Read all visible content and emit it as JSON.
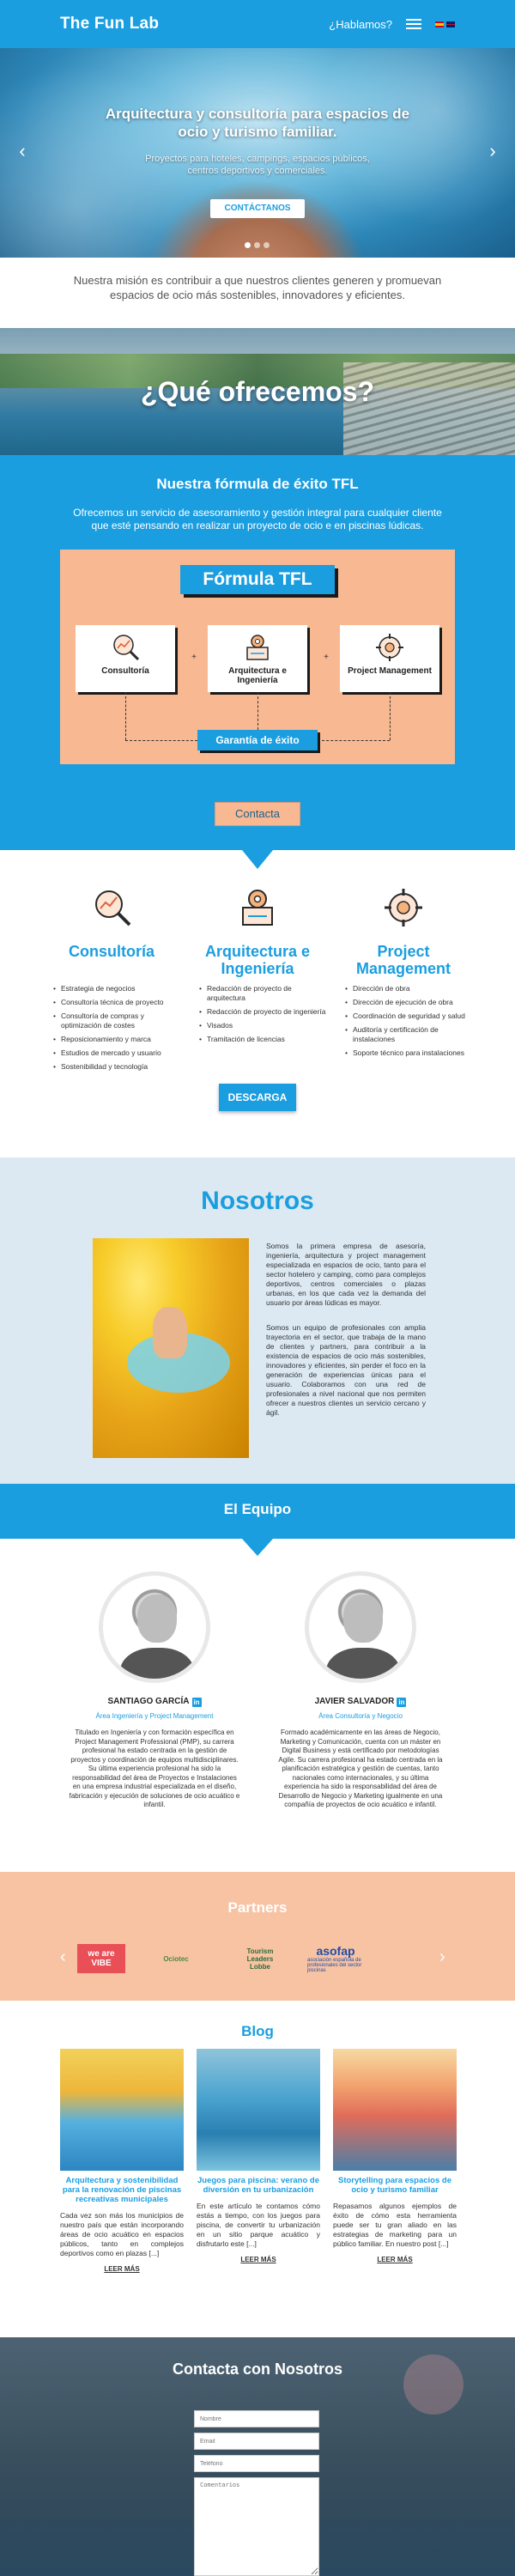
{
  "header": {
    "logo": "The Fun Lab",
    "cta": "¿Hablamos?"
  },
  "hero": {
    "title": "Arquitectura y consultoría para espacios de ocio y turismo familiar.",
    "subtitle": "Proyectos para hoteles, campings, espacios públicos, centros deportivos y comerciales.",
    "button": "CONTÁCTANOS",
    "slides": 3,
    "active_slide": 1
  },
  "mission": "Nuestra misión es contribuir a que nuestros clientes generen y promuevan espacios de ocio más sostenibles, innovadores y eficientes.",
  "offer": {
    "title": "¿Qué ofrecemos?"
  },
  "formula": {
    "heading": "Nuestra fórmula de éxito TFL",
    "description": "Ofrecemos un servicio de asesoramiento y gestión integral para cualquier cliente que esté pensando en realizar un proyecto de ocio e en piscinas lúdicas.",
    "title": "Fórmula TFL",
    "boxes": [
      {
        "label": "Consultoría",
        "icon": "magnifier-chart-icon"
      },
      {
        "label": "Arquitectura e Ingeniería",
        "icon": "blueprint-gear-icon"
      },
      {
        "label": "Project Management",
        "icon": "gear-network-icon"
      }
    ],
    "plus": "+",
    "guarantee": "Garantía de éxito",
    "button": "Contacta"
  },
  "services": {
    "columns": [
      {
        "title": "Consultoría",
        "icon": "magnifier-chart-icon",
        "items": [
          "Estrategia de negocios",
          "Consultoría técnica de proyecto",
          "Consultoría de compras y optimización de costes",
          "Reposicionamiento y marca",
          "Estudios de mercado y usuario",
          "Sostenibilidad y tecnología"
        ]
      },
      {
        "title": "Arquitectura e Ingeniería",
        "icon": "blueprint-gear-icon",
        "items": [
          "Redacción de proyecto de arquitectura",
          "Redacción de proyecto de ingeniería",
          "Visados",
          "Tramitación de licencias"
        ]
      },
      {
        "title": "Project Management",
        "icon": "gear-network-icon",
        "items": [
          "Dirección de obra",
          "Dirección de ejecución de obra",
          "Coordinación de seguridad y salud",
          "Auditoría y certificación de instalaciones",
          "Soporte técnico para instalaciones"
        ]
      }
    ],
    "download": "DESCARGA"
  },
  "about": {
    "title": "Nosotros",
    "paragraphs": [
      "Somos la primera empresa de asesoría, ingeniería, arquitectura y project management especializada en espacios de ocio, tanto para el sector hotelero y camping, como para complejos deportivos, centros comerciales o plazas urbanas, en los que cada vez la demanda del usuario por áreas lúdicas es mayor.",
      "Somos un equipo de profesionales con amplia trayectoria en el sector, que trabaja de la mano de clientes y partners, para contribuir a la existencia de espacios de ocio más sostenibles, innovadores y eficientes, sin perder el foco en la generación de experiencias únicas para el usuario. Colaboramos con una red de profesionales a nivel nacional que nos permiten ofrecer a nuestros clientes un servicio cercano y ágil."
    ]
  },
  "team": {
    "title": "El Equipo",
    "members": [
      {
        "name": "SANTIAGO GARCÍA",
        "role": "Área Ingeniería y Project Management",
        "bio": "Titulado en Ingeniería y con formación específica en Project Management Professional (PMP), su carrera profesional ha estado centrada en la gestión de proyectos y coordinación de equipos multidisciplinares. Su última experiencia profesional ha sido la responsabilidad del área de Proyectos e Instalaciones en una empresa industrial especializada en el diseño, fabricación y ejecución de soluciones de ocio acuático e infantil."
      },
      {
        "name": "JAVIER SALVADOR",
        "role": "Área Consultoría y Negocio",
        "bio": "Formado académicamente en las áreas de Negocio, Marketing y Comunicación, cuenta con un máster en Digital Business y está certificado por metodologías Agile. Su carrera profesional ha estado centrada en la planificación estratégica y gestión de cuentas, tanto nacionales como internacionales, y su última experiencia ha sido la responsabilidad del área de Desarrollo de Negocio y Marketing igualmente en una compañía de proyectos de ocio acuático e infantil."
      }
    ]
  },
  "partners": {
    "title": "Partners",
    "logos": [
      {
        "line1": "we are",
        "line2": "VIBE"
      },
      {
        "text": "Ociotec"
      },
      {
        "line1": "Tourism",
        "line2": "Leaders Lobbe"
      },
      {
        "text": "asofap",
        "tagline": "asociación española de profesionales del sector piscinas"
      }
    ]
  },
  "blog": {
    "title": "Blog",
    "posts": [
      {
        "title": "Arquitectura y sostenibilidad para la renovación de piscinas recreativas municipales",
        "excerpt": "Cada vez son más los municipios de nuestro país que están incorporando áreas de ocio acuático en espacios públicos, tanto en complejos deportivos como en plazas [...]",
        "more": "LEER MÁS"
      },
      {
        "title": "Juegos para piscina: verano de diversión en tu urbanización",
        "excerpt": "En este artículo te contamos cómo estás a tiempo, con los juegos para piscina, de convertir tu urbanización en un sitio parque acuático y disfrutarlo este [...]",
        "more": "LEER MÁS"
      },
      {
        "title": "Storytelling para espacios de ocio y turismo familiar",
        "excerpt": "Repasamos algunos ejemplos de éxito de cómo esta herramienta puede ser tu gran aliado en las estrategias de marketing para un público familiar. En nuestro post [...]",
        "more": "LEER MÁS"
      }
    ]
  },
  "contact": {
    "title": "Contacta con Nosotros",
    "fields": [
      "Nombre",
      "Email",
      "Teléfono"
    ],
    "message": "Comentarios"
  },
  "colors": {
    "primary": "#1a9ee0",
    "peach": "#f8b992",
    "light_blue": "#dce9f3"
  }
}
